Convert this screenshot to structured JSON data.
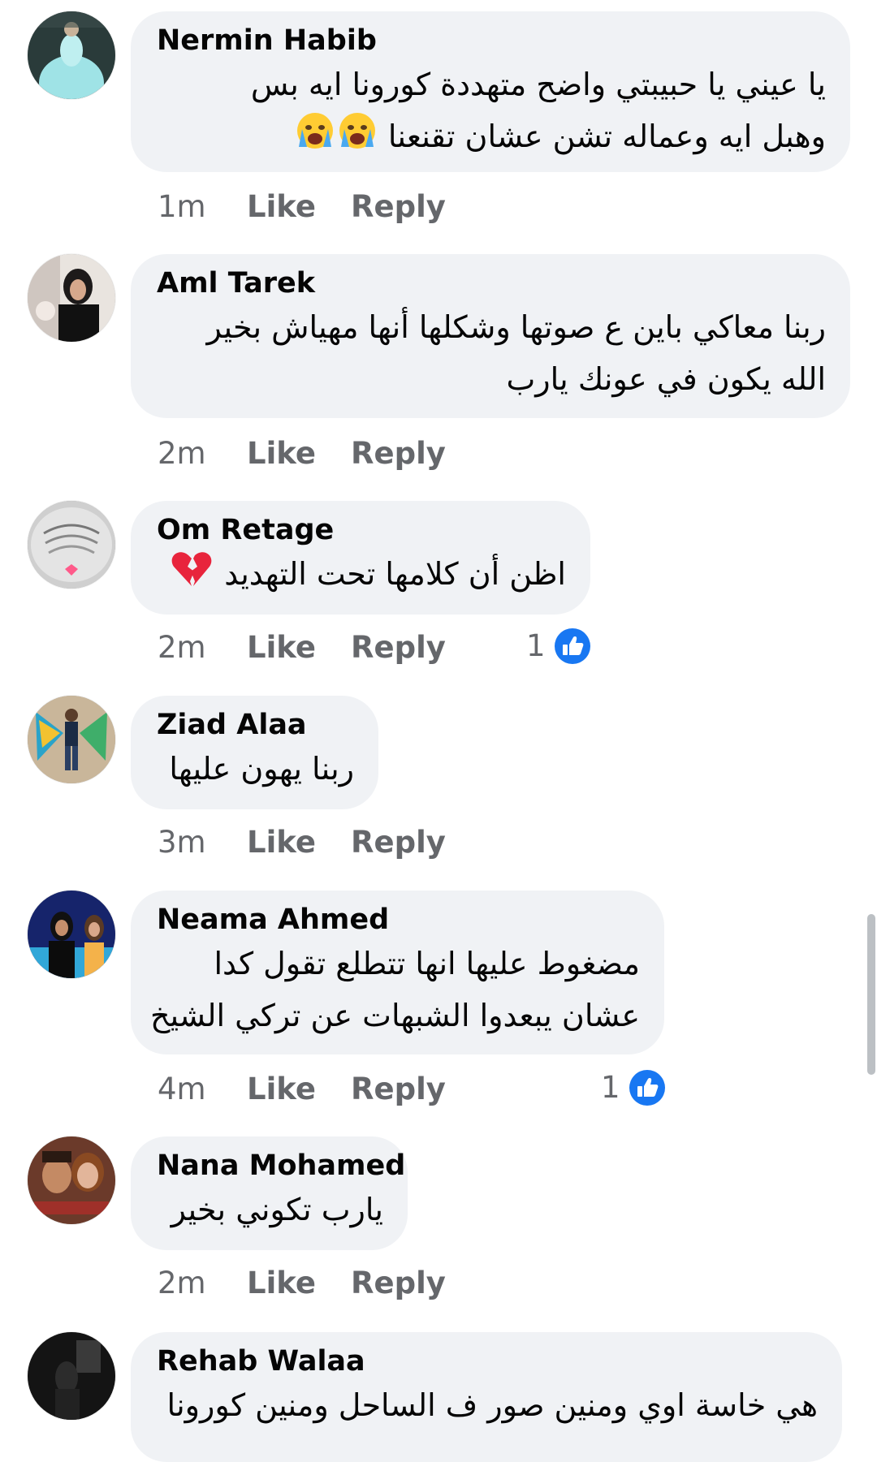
{
  "comments": [
    {
      "author": "Nermin Habib",
      "lines": [
        "يا عيني يا حبيبتي واضح متهددة كورونا ايه بس",
        "وهبل ايه وعماله تشن عشان تقنعنا"
      ],
      "emoji_after_line2": "crying-face-emoji x2",
      "time": "1m",
      "like": "Like",
      "reply": "Reply"
    },
    {
      "author": "Aml Tarek",
      "lines": [
        "ربنا معاكي باين ع صوتها وشكلها أنها مهياش بخير",
        "الله يكون في عونك يارب"
      ],
      "time": "2m",
      "like": "Like",
      "reply": "Reply"
    },
    {
      "author": "Om Retage",
      "lines": [
        "اظن أن كلامها تحت التهديد"
      ],
      "emoji_line1": "broken-heart-emoji",
      "time": "2m",
      "like": "Like",
      "reply": "Reply",
      "reaction_count": "1"
    },
    {
      "author": "Ziad Alaa",
      "lines": [
        "ربنا يهون عليها"
      ],
      "time": "3m",
      "like": "Like",
      "reply": "Reply"
    },
    {
      "author": "Neama Ahmed",
      "lines": [
        "مضغوط عليها انها تتطلع تقول كدا",
        "عشان يبعدوا الشبهات عن تركي الشيخ"
      ],
      "time": "4m",
      "like": "Like",
      "reply": "Reply",
      "reaction_count": "1"
    },
    {
      "author": "Nana Mohamed",
      "lines": [
        "يارب تكوني بخير"
      ],
      "time": "2m",
      "like": "Like",
      "reply": "Reply"
    },
    {
      "author": "Rehab Walaa",
      "lines": [
        "هي خاسة اوي ومنين صور ف الساحل ومنين كورونا"
      ]
    }
  ],
  "colors": {
    "bubble": "#f0f2f5",
    "text": "#050505",
    "secondary": "#65676b",
    "like_blue": "#1877f2",
    "scrollbar": "#bcc0c4"
  }
}
